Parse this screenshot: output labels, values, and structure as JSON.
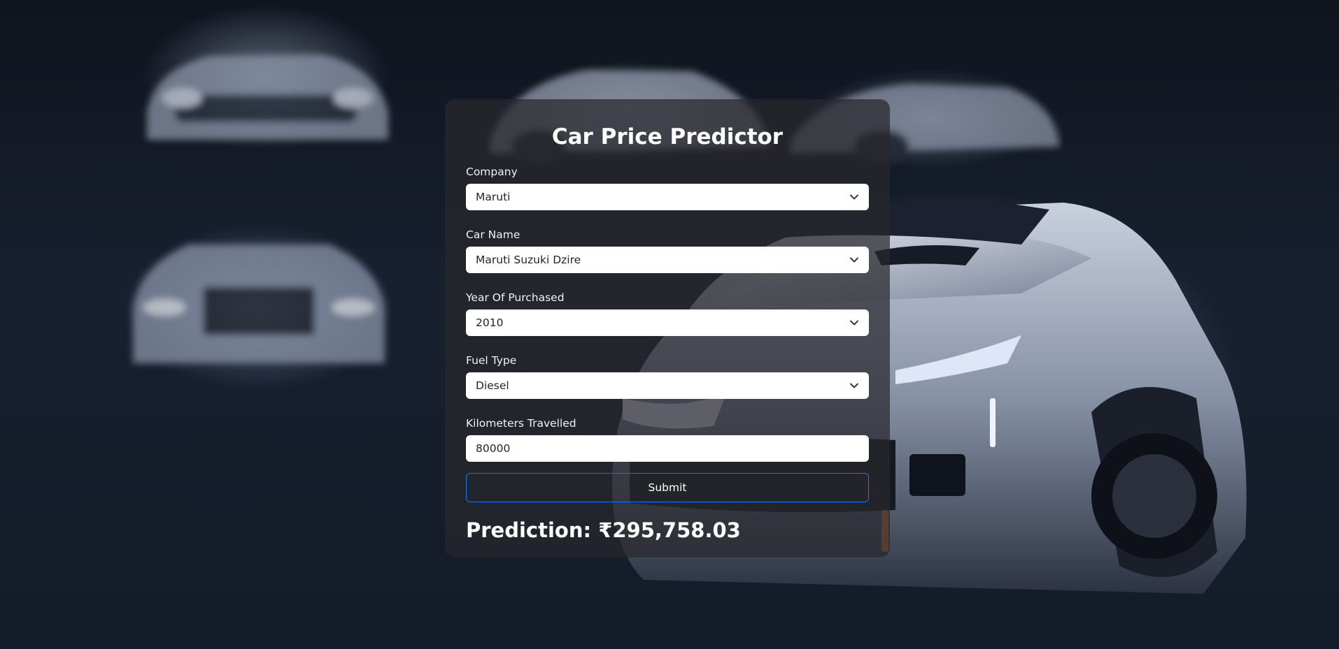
{
  "page": {
    "title": "Car Price Predictor"
  },
  "form": {
    "company": {
      "label": "Company",
      "value": "Maruti"
    },
    "car_name": {
      "label": "Car Name",
      "value": "Maruti Suzuki Dzire"
    },
    "year": {
      "label": "Year Of Purchased",
      "value": "2010"
    },
    "fuel_type": {
      "label": "Fuel Type",
      "value": "Diesel"
    },
    "kms": {
      "label": "Kilometers Travelled",
      "value": "80000"
    },
    "submit_label": "Submit"
  },
  "result": {
    "label": "Prediction:",
    "value": "₹295,758.03"
  },
  "colors": {
    "button_border": "#1a73e8",
    "card_bg": "#28282c"
  }
}
